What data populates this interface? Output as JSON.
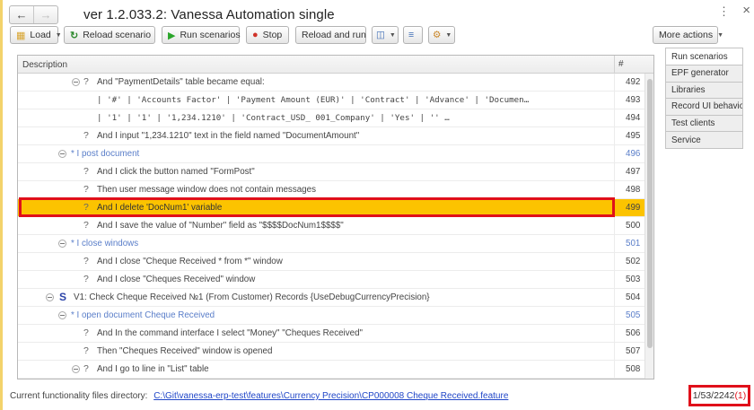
{
  "window": {
    "title": "ver 1.2.033.2: Vanessa Automation single",
    "back_icon": "arrow-left-icon",
    "forward_icon": "arrow-right-icon",
    "more_icon": "vertical-dots-icon",
    "close_icon": "close-icon"
  },
  "toolbar": {
    "load_label": "Load",
    "reload_label": "Reload scenario",
    "run_label": "Run scenarios",
    "stop_label": "Stop",
    "reload_run_label": "Reload and run",
    "more_actions_label": "More actions"
  },
  "tabs": [
    {
      "label": "Run scenarios"
    },
    {
      "label": "EPF generator"
    },
    {
      "label": "Libraries"
    },
    {
      "label": "Record UI behavior"
    },
    {
      "label": "Test clients"
    },
    {
      "label": "Service"
    }
  ],
  "grid": {
    "columns": {
      "description": "Description",
      "number": "#"
    },
    "rows": [
      {
        "text": "And \"PaymentDetails\" table became equal:",
        "num": "492"
      },
      {
        "text": "| '#' | 'Accounts Factor' | 'Payment Amount (EUR)' | 'Contract'                | 'Advance' | 'Documen…",
        "num": "493"
      },
      {
        "text": "| '1' | '1'               | '1,234.1210'           | 'Contract_USD_ 001_Company' | 'Yes'     | ''      …",
        "num": "494"
      },
      {
        "text": "And I input \"1,234.1210\" text in the field named \"DocumentAmount\"",
        "num": "495"
      },
      {
        "text": "* I post document",
        "num": "496"
      },
      {
        "text": "And I click the button named \"FormPost\"",
        "num": "497"
      },
      {
        "text": "Then user message window does not contain messages",
        "num": "498"
      },
      {
        "text": "And I delete 'DocNum1' variable",
        "num": "499"
      },
      {
        "text": "And I save the value of \"Number\" field as \"$$$$DocNum1$$$$\"",
        "num": "500"
      },
      {
        "text": "* I close windows",
        "num": "501"
      },
      {
        "text": "And I close \"Cheque Received * from *\" window",
        "num": "502"
      },
      {
        "text": "And I close \"Cheques Received\" window",
        "num": "503"
      },
      {
        "text": "V1: Check Cheque Received №1 (From Customer) Records {UseDebugCurrencyPrecision}",
        "num": "504"
      },
      {
        "text": "* I open document Cheque Received",
        "num": "505"
      },
      {
        "text": "And In the command interface I select \"Money\" \"Cheques Received\"",
        "num": "506"
      },
      {
        "text": "Then \"Cheques Received\" window is opened",
        "num": "507"
      },
      {
        "text": "And I go to line in \"List\" table",
        "num": "508"
      }
    ],
    "scenario_mark": "S",
    "step_mark": "?"
  },
  "footer": {
    "label": "Current functionality files directory:",
    "path": "C:\\Git\\vanessa-erp-test\\features\\Currency Precision\\CP000008 Cheque Received.feature",
    "counter_main": "1/53/2242",
    "counter_errors": "(1)"
  },
  "colors": {
    "highlight_row": "#fcc300",
    "annotation_frame": "#e0101a",
    "link": "#2046c8",
    "scenario_text": "#5a7ec9"
  }
}
